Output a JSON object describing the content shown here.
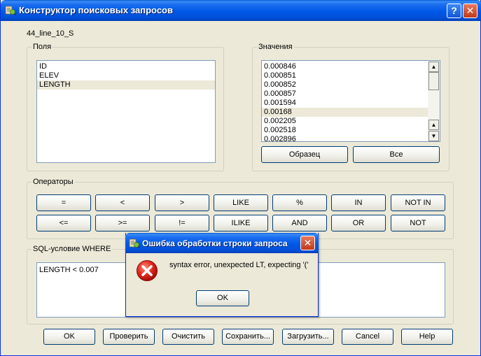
{
  "window": {
    "title": "Конструктор поисковых запросов",
    "help_btn": "?",
    "close_btn": "✕"
  },
  "layer_name": "44_line_10_S",
  "fields": {
    "label": "Поля",
    "items": [
      "ID",
      "ELEV",
      "LENGTH"
    ],
    "selected": "LENGTH"
  },
  "values": {
    "label": "Значения",
    "items": [
      "0.000846",
      "0.000851",
      "0.000852",
      "0.000857",
      "0.001594",
      "0.00168",
      "0.002205",
      "0.002518",
      "0.002896"
    ],
    "selected": "0.00168",
    "sample_btn": "Образец",
    "all_btn": "Все"
  },
  "operators": {
    "label": "Операторы",
    "row1": [
      "=",
      "<",
      ">",
      "LIKE",
      "%",
      "IN",
      "NOT IN"
    ],
    "row2": [
      "<=",
      ">=",
      "!=",
      "ILIKE",
      "AND",
      "OR",
      "NOT"
    ]
  },
  "sql": {
    "label": "SQL-условие WHERE",
    "value": "LENGTH < 0.007"
  },
  "bottom_buttons": {
    "ok": "OK",
    "test": "Проверить",
    "clear": "Очистить",
    "save": "Сохранить...",
    "load": "Загрузить...",
    "cancel": "Cancel",
    "help": "Help"
  },
  "error_dialog": {
    "title": "Ошибка обработки строки запроса",
    "message": "syntax error, unexpected LT, expecting '('",
    "ok": "OK",
    "close_btn": "✕"
  },
  "colors": {
    "titlebar": "#0058e6",
    "face": "#ece9d8",
    "error_red": "#d4201c"
  }
}
